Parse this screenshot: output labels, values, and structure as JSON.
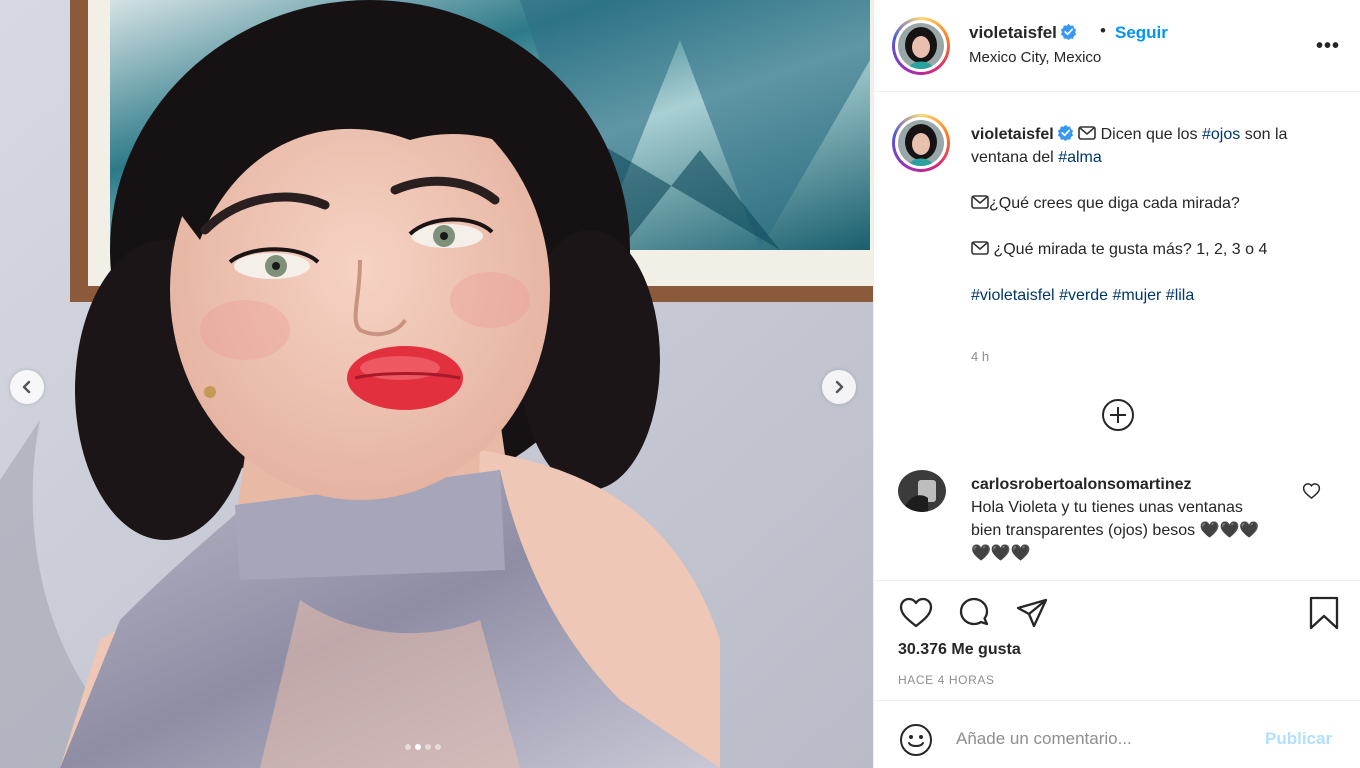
{
  "post": {
    "username": "violetaisfel",
    "follow_separator": "•",
    "follow_label": "Seguir",
    "location": "Mexico City, Mexico",
    "more_label": "•••"
  },
  "media": {
    "slide_count": 4,
    "active_slide": 2
  },
  "caption": {
    "username": "violetaisfel",
    "line1_text": " Dicen que los ",
    "tag_ojos": "#ojos",
    "line1b_text": " son la ventana del ",
    "tag_alma": "#alma",
    "para2": "¿Qué crees que diga cada mirada?",
    "para3": " ¿Qué mirada te gusta más? 1, 2, 3 o 4",
    "hashtags": [
      "#violetaisfel",
      "#verde",
      "#mujer",
      "#lila"
    ],
    "time": "4 h"
  },
  "comment": {
    "username": "carlosrobertoalonsomartinez",
    "text": "Hola Violeta y tu tienes unas ventanas bien transparentes (ojos) besos 🖤🖤🖤🖤🖤🖤"
  },
  "stats": {
    "likes": "30.376 Me gusta",
    "time_ago": "HACE 4 HORAS"
  },
  "add_comment": {
    "placeholder": "Añade un comentario...",
    "publish_label": "Publicar"
  },
  "colors": {
    "accent": "#0095f6",
    "publish_disabled": "#b2dffc",
    "hashtag": "#00376b",
    "verified": "#3897f0"
  }
}
